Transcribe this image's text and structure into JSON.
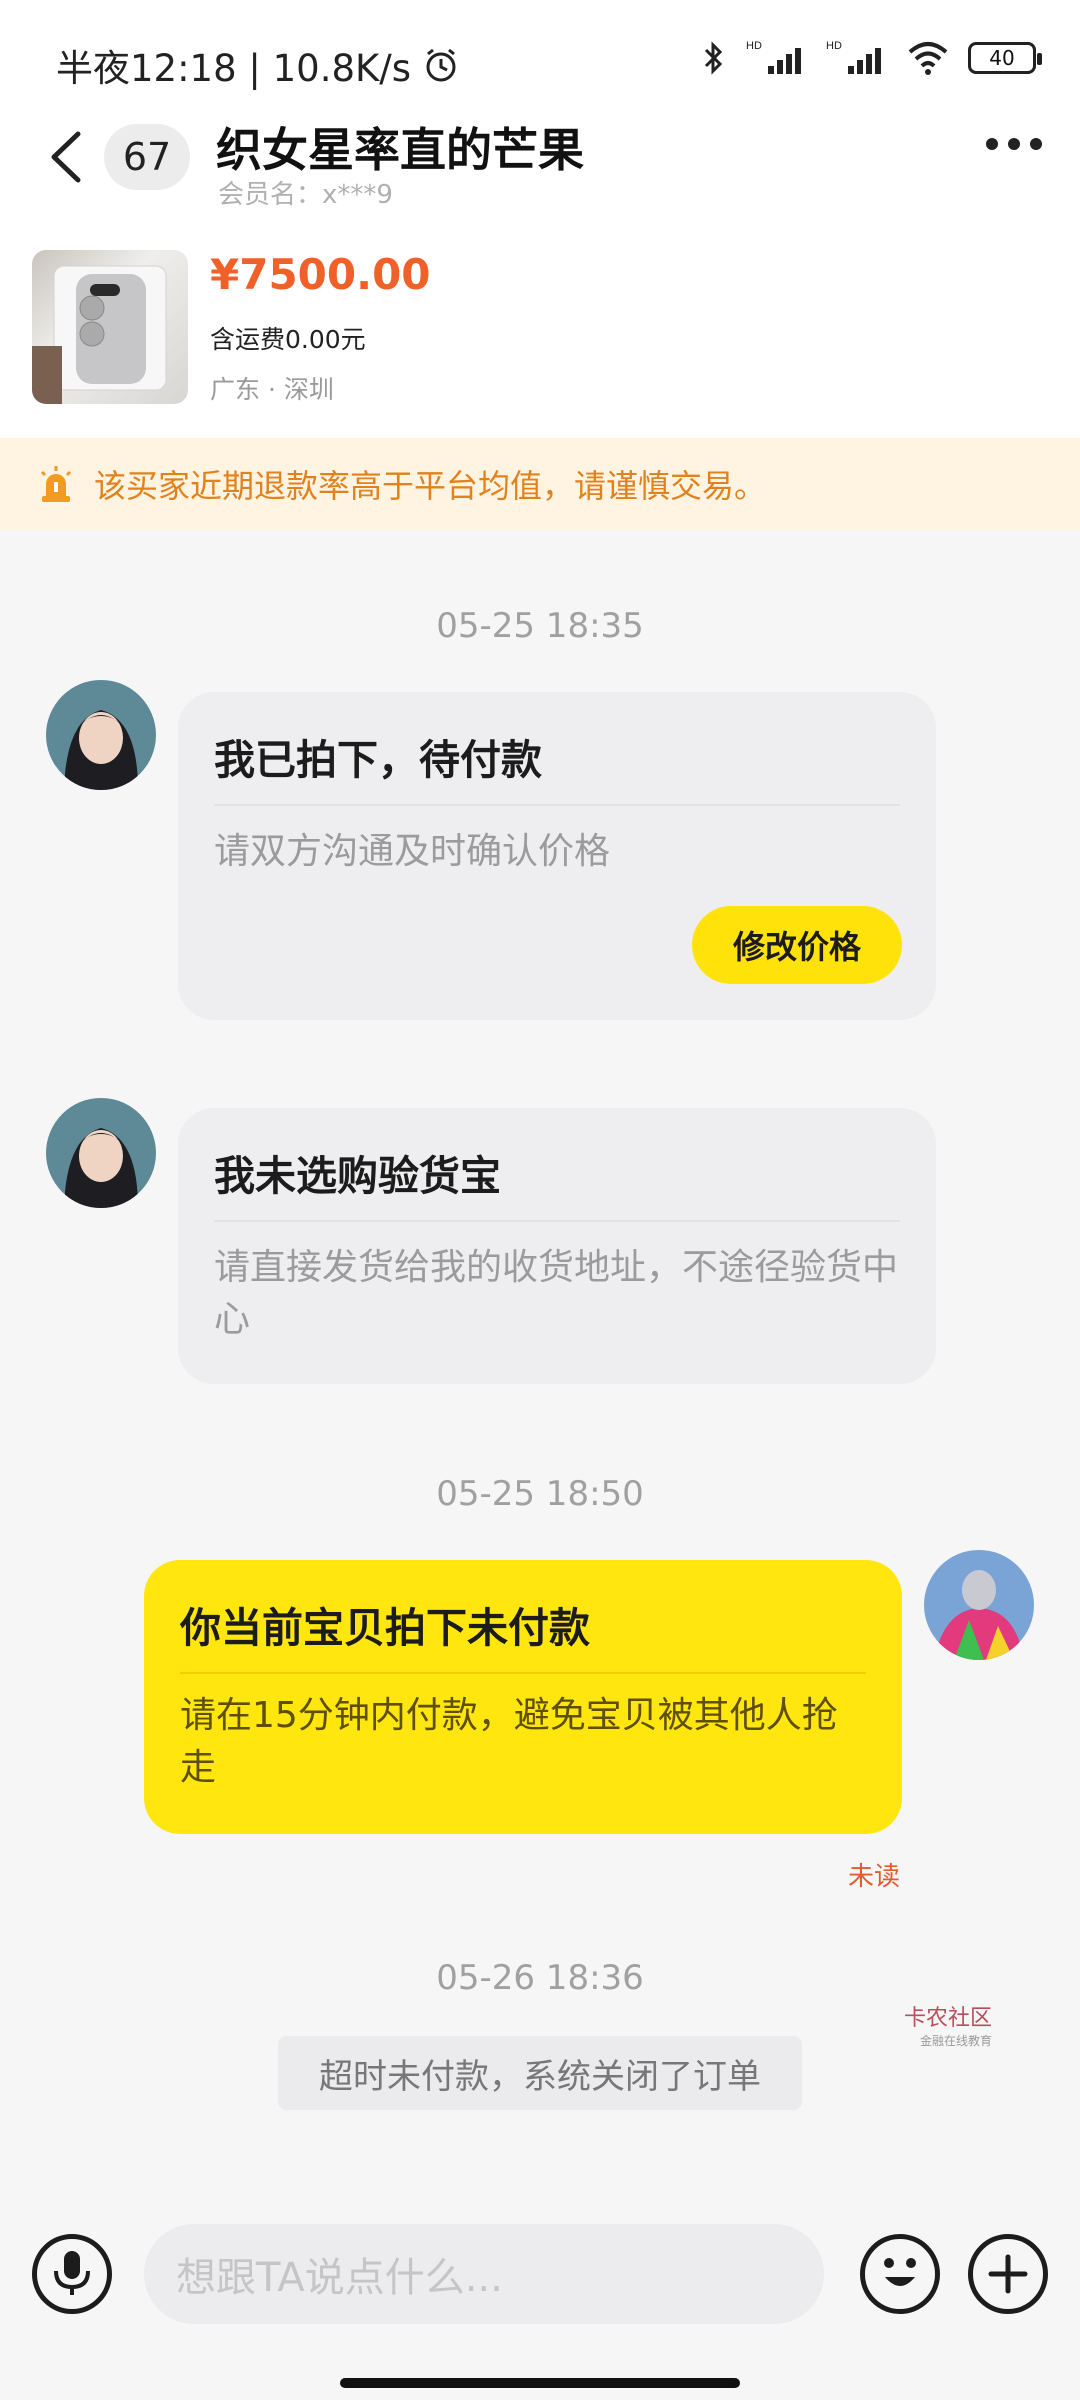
{
  "status_bar": {
    "time_text": "半夜12:18 | 10.8K/s",
    "battery": "40"
  },
  "header": {
    "badge_count": "67",
    "title": "织女星率直的芒果",
    "subtitle": "会员名：x***9"
  },
  "product": {
    "price": "¥7500.00",
    "shipping": "含运费0.00元",
    "location": "广东 · 深圳"
  },
  "warning": {
    "text": "该买家近期退款率高于平台均值，请谨慎交易。"
  },
  "messages": [
    {
      "timestamp": "05-25 18:35",
      "title": "我已拍下，待付款",
      "body": "请双方沟通及时确认价格",
      "button": "修改价格"
    },
    {
      "title": "我未选购验货宝",
      "body": "请直接发货给我的收货地址，不途径验货中心"
    },
    {
      "timestamp": "05-25 18:50",
      "title": "你当前宝贝拍下未付款",
      "body": "请在15分钟内付款，避免宝贝被其他人抢走",
      "status": "未读"
    }
  ],
  "system": {
    "timestamp": "05-26 18:36",
    "note": "超时未付款，系统关闭了订单"
  },
  "composer": {
    "placeholder": "想跟TA说点什么..."
  },
  "watermark": {
    "main": "卡农社区",
    "sub": "金融在线教育"
  },
  "colors": {
    "accent_yellow": "#ffe20a",
    "price_orange": "#f0612a",
    "warning_orange": "#e2821c",
    "warning_bg": "#fff3e2"
  }
}
